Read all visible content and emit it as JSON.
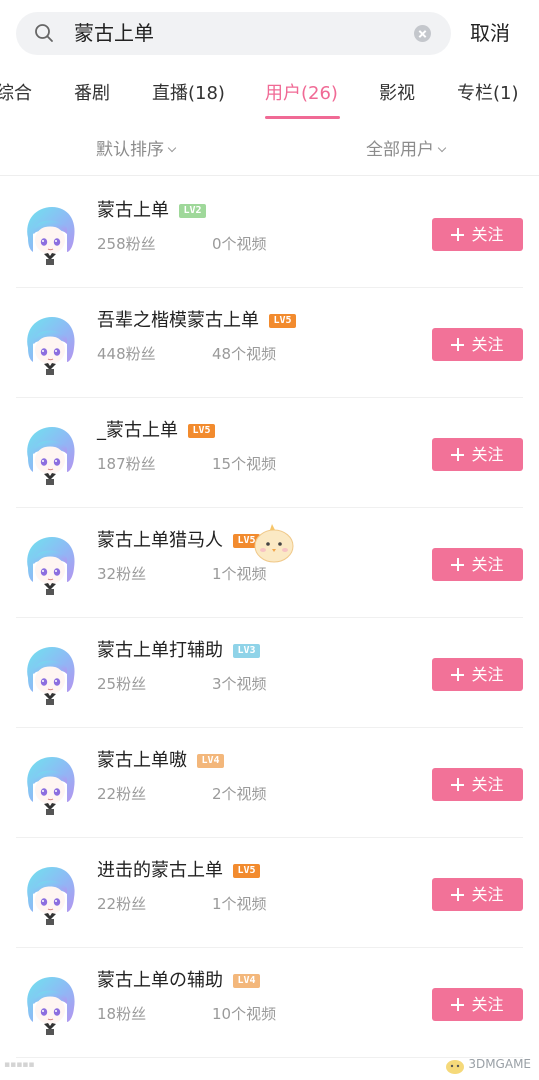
{
  "search": {
    "value": "蒙古上单",
    "cancel_label": "取消"
  },
  "tabs": [
    {
      "label": "综合"
    },
    {
      "label": "番剧"
    },
    {
      "label": "直播(18)"
    },
    {
      "label": "用户(26)",
      "active": true
    },
    {
      "label": "影视"
    },
    {
      "label": "专栏(1)"
    }
  ],
  "filters": {
    "sort_label": "默认排序",
    "user_type_label": "全部用户"
  },
  "follow_label": "关注",
  "users": [
    {
      "name": "蒙古上单",
      "level": "LV2",
      "fans": "258粉丝",
      "videos": "0个视频"
    },
    {
      "name": "吾辈之楷模蒙古上单",
      "level": "LV5",
      "fans": "448粉丝",
      "videos": "48个视频"
    },
    {
      "name": "_蒙古上单",
      "level": "LV5",
      "fans": "187粉丝",
      "videos": "15个视频"
    },
    {
      "name": "蒙古上单猎马人",
      "level": "LV5",
      "fans": "32粉丝",
      "videos": "1个视频"
    },
    {
      "name": "蒙古上单打辅助",
      "level": "LV3",
      "fans": "25粉丝",
      "videos": "3个视频"
    },
    {
      "name": "蒙古上单嗷",
      "level": "LV4",
      "fans": "22粉丝",
      "videos": "2个视频"
    },
    {
      "name": "进击的蒙古上单",
      "level": "LV5",
      "fans": "22粉丝",
      "videos": "1个视频"
    },
    {
      "name": "蒙古上单の辅助",
      "level": "LV4",
      "fans": "18粉丝",
      "videos": "10个视频"
    }
  ],
  "level_colors": {
    "LV2": "#9fd89a",
    "LV3": "#8fd3e8",
    "LV4": "#f3b77b",
    "LV5": "#f28b2e"
  },
  "accent_color": "#f06a95",
  "watermark": "3DMGAME"
}
